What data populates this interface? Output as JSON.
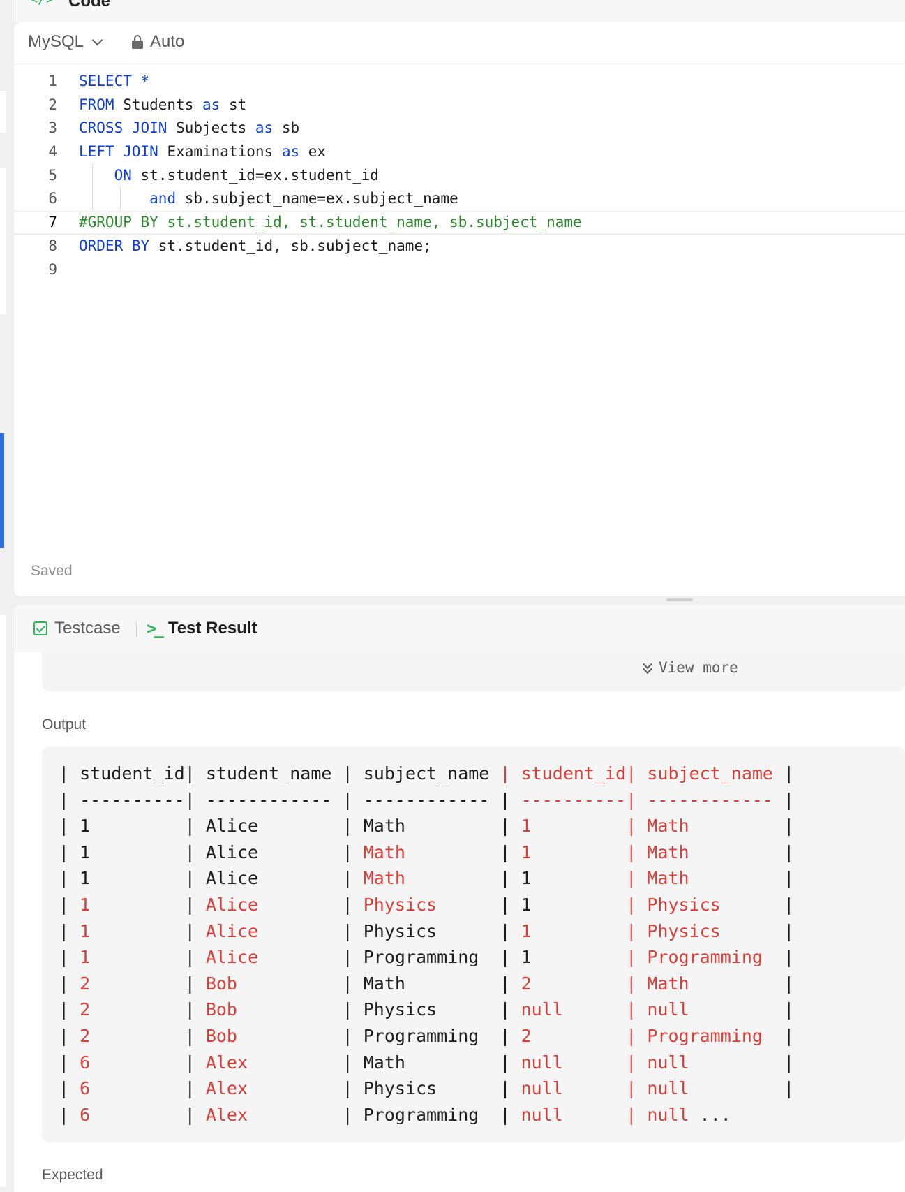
{
  "header": {
    "icon": "</>",
    "title": "Code"
  },
  "editor": {
    "language": "MySQL",
    "mode": "Auto",
    "status": "Saved",
    "lines": [
      {
        "n": "1",
        "tokens": [
          [
            "kw",
            "SELECT *"
          ]
        ]
      },
      {
        "n": "2",
        "tokens": [
          [
            "kw",
            "FROM"
          ],
          [
            "pl",
            " Students "
          ],
          [
            "kw",
            "as"
          ],
          [
            "pl",
            " st"
          ]
        ]
      },
      {
        "n": "3",
        "tokens": [
          [
            "kw",
            "CROSS JOIN"
          ],
          [
            "pl",
            " Subjects "
          ],
          [
            "kw",
            "as"
          ],
          [
            "pl",
            " sb"
          ]
        ]
      },
      {
        "n": "4",
        "tokens": [
          [
            "kw",
            "LEFT JOIN"
          ],
          [
            "pl",
            " Examinations "
          ],
          [
            "kw",
            "as"
          ],
          [
            "pl",
            " ex"
          ]
        ]
      },
      {
        "n": "5",
        "tokens": [
          [
            "pl",
            "    "
          ],
          [
            "kw",
            "ON"
          ],
          [
            "pl",
            " st.student_id=ex.student_id"
          ]
        ]
      },
      {
        "n": "6",
        "tokens": [
          [
            "pl",
            "        "
          ],
          [
            "kw",
            "and"
          ],
          [
            "pl",
            " sb.subject_name=ex.subject_name"
          ]
        ]
      },
      {
        "n": "7",
        "tokens": [
          [
            "cm",
            "#GROUP BY st.student_id, st.student_name, sb.subject_name"
          ]
        ]
      },
      {
        "n": "8",
        "tokens": [
          [
            "kw",
            "ORDER BY"
          ],
          [
            "pl",
            " st.student_id, sb.subject_name;"
          ]
        ]
      },
      {
        "n": "9",
        "tokens": []
      }
    ]
  },
  "tabs": {
    "testcase": "Testcase",
    "result": "Test Result"
  },
  "view_more": "View more",
  "output": {
    "label": "Output",
    "header": [
      "student_id",
      "student_name",
      "subject_name",
      "student_id",
      "subject_name"
    ],
    "header_red": [
      false,
      false,
      false,
      true,
      true
    ],
    "rows": [
      [
        [
          "1",
          0
        ],
        [
          "Alice",
          0
        ],
        [
          "Math",
          0
        ],
        [
          "1",
          1
        ],
        [
          "Math",
          1
        ]
      ],
      [
        [
          "1",
          0
        ],
        [
          "Alice",
          0
        ],
        [
          "Math",
          1
        ],
        [
          "1",
          1
        ],
        [
          "Math",
          1
        ]
      ],
      [
        [
          "1",
          0
        ],
        [
          "Alice",
          0
        ],
        [
          "Math",
          1
        ],
        [
          "1",
          0
        ],
        [
          "Math",
          1
        ]
      ],
      [
        [
          "1",
          1
        ],
        [
          "Alice",
          1
        ],
        [
          "Physics",
          1
        ],
        [
          "1",
          0
        ],
        [
          "Physics",
          1
        ]
      ],
      [
        [
          "1",
          1
        ],
        [
          "Alice",
          1
        ],
        [
          "Physics",
          0
        ],
        [
          "1",
          1
        ],
        [
          "Physics",
          1
        ]
      ],
      [
        [
          "1",
          1
        ],
        [
          "Alice",
          1
        ],
        [
          "Programming",
          0
        ],
        [
          "1",
          0
        ],
        [
          "Programming",
          1
        ]
      ],
      [
        [
          "2",
          1
        ],
        [
          "Bob",
          1
        ],
        [
          "Math",
          0
        ],
        [
          "2",
          1
        ],
        [
          "Math",
          1
        ]
      ],
      [
        [
          "2",
          1
        ],
        [
          "Bob",
          1
        ],
        [
          "Physics",
          0
        ],
        [
          "null",
          1
        ],
        [
          "null",
          1
        ]
      ],
      [
        [
          "2",
          1
        ],
        [
          "Bob",
          1
        ],
        [
          "Programming",
          0
        ],
        [
          "2",
          1
        ],
        [
          "Programming",
          1
        ]
      ],
      [
        [
          "6",
          1
        ],
        [
          "Alex",
          1
        ],
        [
          "Math",
          0
        ],
        [
          "null",
          1
        ],
        [
          "null",
          1
        ]
      ],
      [
        [
          "6",
          1
        ],
        [
          "Alex",
          1
        ],
        [
          "Physics",
          0
        ],
        [
          "null",
          1
        ],
        [
          "null",
          1
        ]
      ],
      [
        [
          "6",
          1
        ],
        [
          "Alex",
          1
        ],
        [
          "Programming",
          0
        ],
        [
          "null",
          1
        ],
        [
          "null",
          1
        ]
      ]
    ],
    "truncation": "..."
  },
  "expected_label": "Expected",
  "colors": {
    "keyword": "#0b3cd9",
    "comment": "#2c8a2c",
    "diff_red": "#d9403a",
    "accent_green": "#2db55d",
    "sidebar_blue": "#2f6fe4"
  }
}
